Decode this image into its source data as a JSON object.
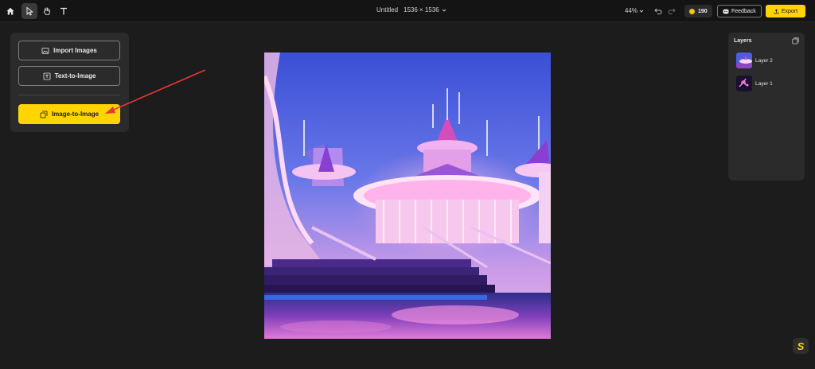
{
  "toolbar": {
    "tools": [
      "home-icon",
      "select-cursor-icon",
      "hand-pan-icon",
      "text-tool-icon"
    ],
    "doc_title": "Untitled",
    "doc_size": "1536 × 1536",
    "zoom": "44%",
    "credits": "190",
    "feedback_label": "Feedback",
    "export_label": "Export",
    "accent": "#ffd400"
  },
  "left_panel": {
    "import_label": "Import Images",
    "t2i_label": "Text-to-Image",
    "i2i_label": "Image-to-Image"
  },
  "layers": {
    "title": "Layers",
    "items": [
      {
        "label": "Layer 2"
      },
      {
        "label": "Layer 1"
      }
    ]
  },
  "fab_label": "S"
}
